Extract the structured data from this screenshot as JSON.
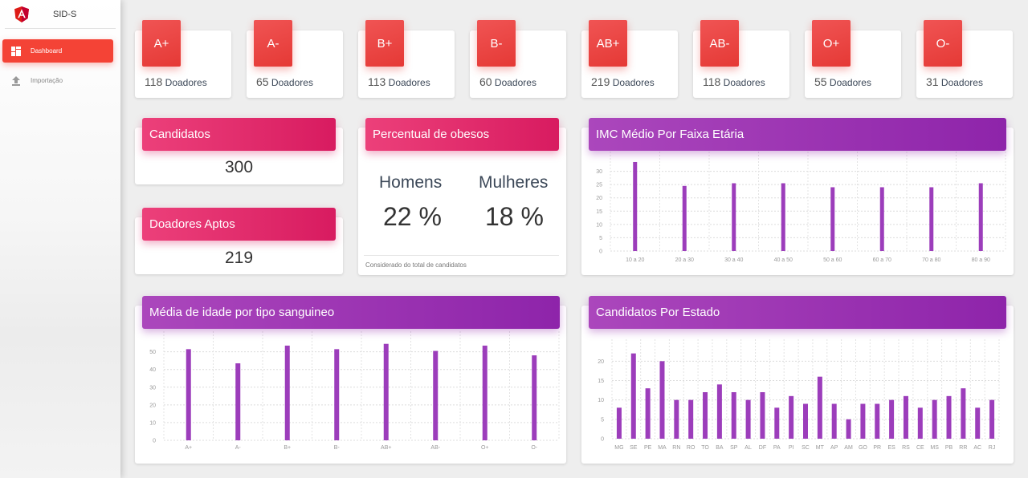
{
  "sidebar": {
    "title": "SID-S",
    "items": [
      {
        "label": "Dashboard",
        "icon": "dashboard-icon",
        "active": true
      },
      {
        "label": "Importação",
        "icon": "upload-icon",
        "active": false
      }
    ]
  },
  "blood_types": [
    {
      "type": "A+",
      "count": "118",
      "suffix": "Doadores"
    },
    {
      "type": "A-",
      "count": "65",
      "suffix": "Doadores"
    },
    {
      "type": "B+",
      "count": "113",
      "suffix": "Doadores"
    },
    {
      "type": "B-",
      "count": "60",
      "suffix": "Doadores"
    },
    {
      "type": "AB+",
      "count": "219",
      "suffix": "Doadores"
    },
    {
      "type": "AB-",
      "count": "118",
      "suffix": "Doadores"
    },
    {
      "type": "O+",
      "count": "55",
      "suffix": "Doadores"
    },
    {
      "type": "O-",
      "count": "31",
      "suffix": "Doadores"
    }
  ],
  "candidatos": {
    "title": "Candidatos",
    "value": "300"
  },
  "aptos": {
    "title": "Doadores Aptos",
    "value": "219"
  },
  "obesos": {
    "title": "Percentual de obesos",
    "men_label": "Homens",
    "men_value": "22 %",
    "women_label": "Mulheres",
    "women_value": "18 %",
    "footnote": "Considerado do total de candidatos"
  },
  "colors": {
    "accent_red": "#f44336",
    "pink": "#d81b60",
    "purple": "#8e24aa",
    "bar": "#9c3dbb"
  },
  "chart_data": [
    {
      "type": "bar",
      "title": "IMC Médio Por Faixa Etária",
      "categories": [
        "10 a 20",
        "20 a 30",
        "30 a 40",
        "40 a 50",
        "50 a 60",
        "60 a 70",
        "70 a 80",
        "80 a 90"
      ],
      "values": [
        33.5,
        24.5,
        25.5,
        25.5,
        24,
        24,
        24,
        25.5
      ],
      "yticks": [
        0,
        5,
        10,
        15,
        20,
        25,
        30
      ],
      "ylim": [
        0,
        35
      ],
      "grid": true
    },
    {
      "type": "bar",
      "title": "Média de idade por tipo sanguineo",
      "categories": [
        "A+",
        "A-",
        "B+",
        "B-",
        "AB+",
        "AB-",
        "O+",
        "O-"
      ],
      "values": [
        51.5,
        43.5,
        53.5,
        51.5,
        54.5,
        50.5,
        53.5,
        48
      ],
      "yticks": [
        0,
        10,
        20,
        30,
        40,
        50
      ],
      "ylim": [
        0,
        58
      ],
      "grid": true
    },
    {
      "type": "bar",
      "title": "Candidatos Por Estado",
      "categories": [
        "MG",
        "SE",
        "PE",
        "MA",
        "RN",
        "RO",
        "TO",
        "BA",
        "SP",
        "AL",
        "DF",
        "PA",
        "PI",
        "SC",
        "MT",
        "AP",
        "AM",
        "GO",
        "PR",
        "ES",
        "RS",
        "CE",
        "MS",
        "PB",
        "RR",
        "AC",
        "RJ"
      ],
      "values": [
        8,
        22,
        13,
        20,
        10,
        10,
        12,
        14,
        12,
        10,
        12,
        8,
        11,
        9,
        16,
        9,
        5,
        9,
        9,
        10,
        11,
        8,
        10,
        11,
        13,
        8,
        10
      ],
      "yticks": [
        0,
        5,
        10,
        15,
        20
      ],
      "ylim": [
        0,
        24
      ],
      "grid": true
    }
  ]
}
